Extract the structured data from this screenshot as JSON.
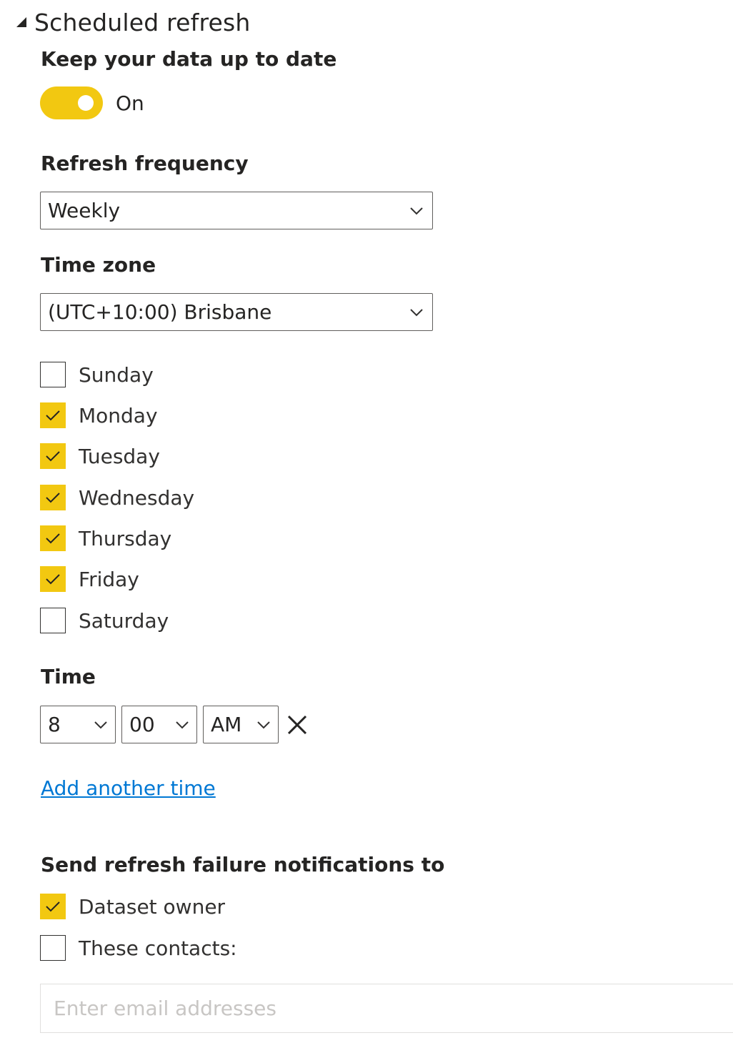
{
  "section": {
    "title": "Scheduled refresh"
  },
  "keep_up_to_date": {
    "label": "Keep your data up to date",
    "toggle_state": "On",
    "accent_color": "#F2C811"
  },
  "refresh_frequency": {
    "label": "Refresh frequency",
    "selected": "Weekly"
  },
  "time_zone": {
    "label": "Time zone",
    "selected": "(UTC+10:00) Brisbane"
  },
  "days": [
    {
      "label": "Sunday",
      "checked": false
    },
    {
      "label": "Monday",
      "checked": true
    },
    {
      "label": "Tuesday",
      "checked": true
    },
    {
      "label": "Wednesday",
      "checked": true
    },
    {
      "label": "Thursday",
      "checked": true
    },
    {
      "label": "Friday",
      "checked": true
    },
    {
      "label": "Saturday",
      "checked": false
    }
  ],
  "time": {
    "label": "Time",
    "hour": "8",
    "minute": "00",
    "period": "AM",
    "remove_icon": "close-icon"
  },
  "add_time_link": {
    "label": "Add another time",
    "color": "#0078D4"
  },
  "notifications": {
    "label": "Send refresh failure notifications to",
    "options": [
      {
        "label": "Dataset owner",
        "checked": true
      },
      {
        "label": "These contacts:",
        "checked": false
      }
    ],
    "email_placeholder": "Enter email addresses"
  }
}
